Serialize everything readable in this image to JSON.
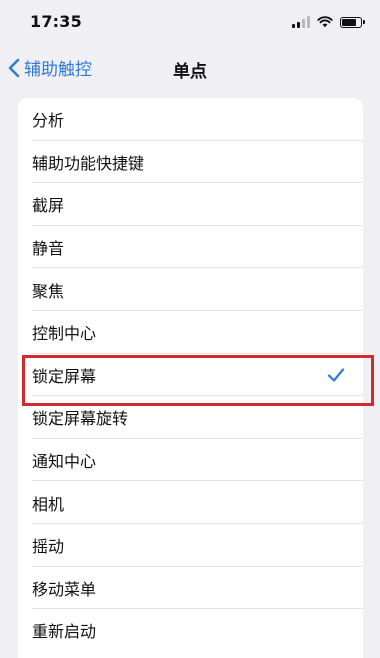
{
  "status_bar": {
    "time": "17:35",
    "icons": [
      "cellular-signal-icon",
      "wifi-icon",
      "battery-icon"
    ],
    "battery_level": 0.85
  },
  "nav": {
    "back_label": "辅助触控",
    "title": "单点"
  },
  "list": {
    "items": [
      {
        "label": "分析",
        "selected": false
      },
      {
        "label": "辅助功能快捷键",
        "selected": false
      },
      {
        "label": "截屏",
        "selected": false
      },
      {
        "label": "静音",
        "selected": false
      },
      {
        "label": "聚焦",
        "selected": false
      },
      {
        "label": "控制中心",
        "selected": false
      },
      {
        "label": "锁定屏幕",
        "selected": true
      },
      {
        "label": "锁定屏幕旋转",
        "selected": false
      },
      {
        "label": "通知中心",
        "selected": false
      },
      {
        "label": "相机",
        "selected": false
      },
      {
        "label": "摇动",
        "selected": false
      },
      {
        "label": "移动菜单",
        "selected": false
      },
      {
        "label": "重新启动",
        "selected": false
      }
    ]
  },
  "colors": {
    "accent": "#2f7bd8",
    "highlight_box": "#d42a2f",
    "background": "#f0f0f4",
    "cell": "#ffffff"
  }
}
